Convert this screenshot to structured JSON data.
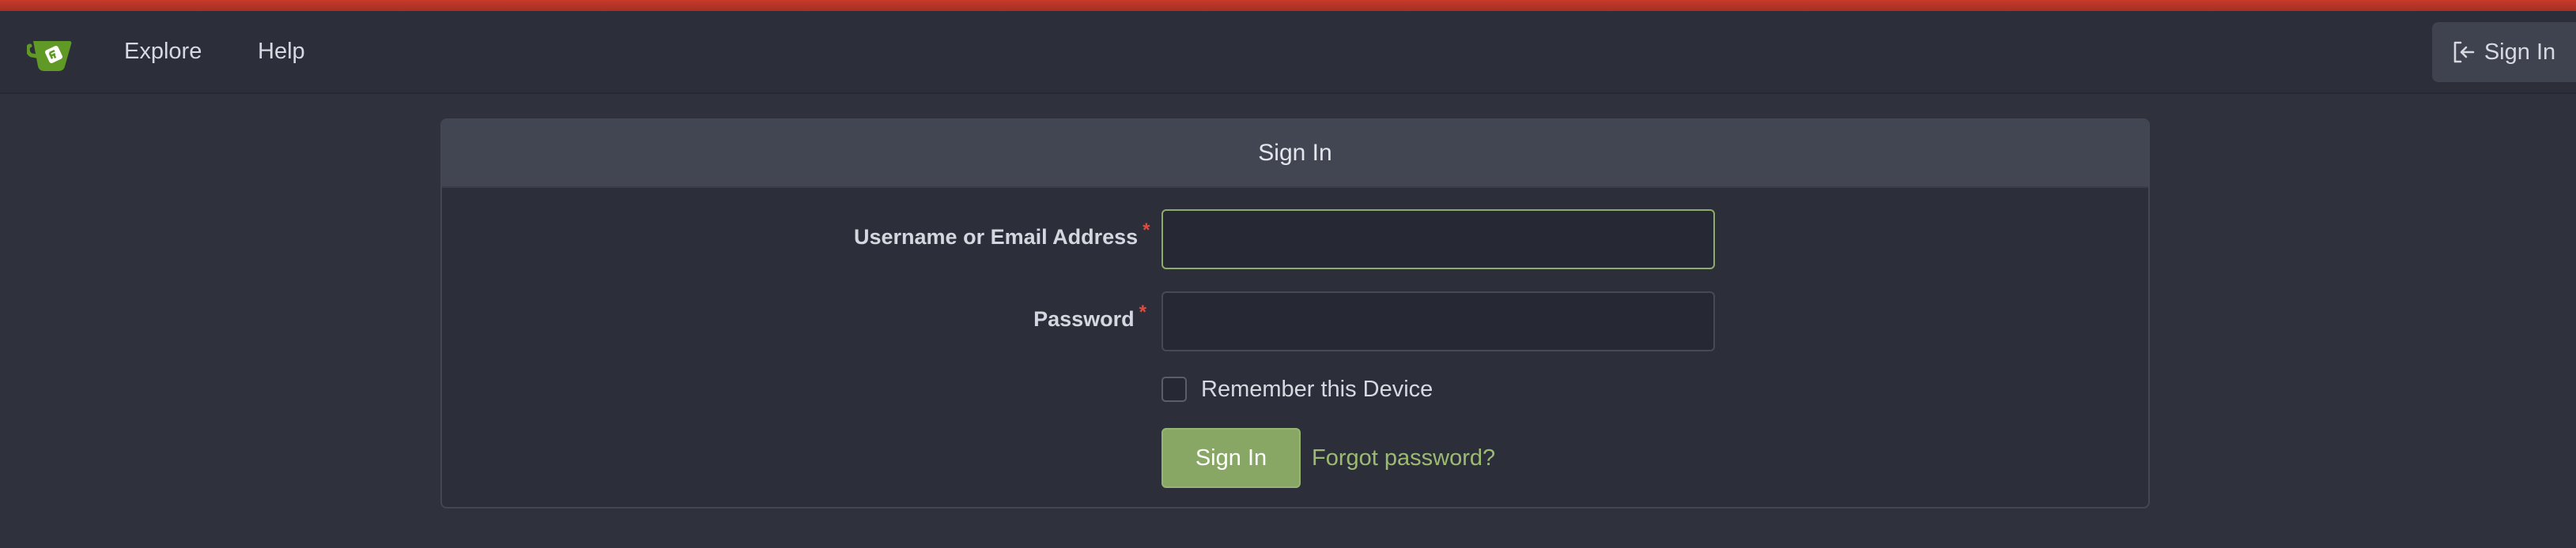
{
  "navbar": {
    "logo_icon": "gitea-teacup-logo-icon",
    "links": [
      {
        "label": "Explore"
      },
      {
        "label": "Help"
      }
    ],
    "signin_label": "Sign In",
    "signin_icon": "sign-in-icon"
  },
  "form": {
    "title": "Sign In",
    "username_label": "Username or Email Address",
    "password_label": "Password",
    "required_mark": "*",
    "username_value": "",
    "password_value": "",
    "remember_label": "Remember this Device",
    "remember_checked": false,
    "submit_label": "Sign In",
    "forgot_label": "Forgot password?"
  },
  "colors": {
    "accent_bar": "#c7392b",
    "primary_button": "#88a765",
    "link": "#9dba73",
    "required": "#e04c40",
    "background": "#2f323d"
  }
}
